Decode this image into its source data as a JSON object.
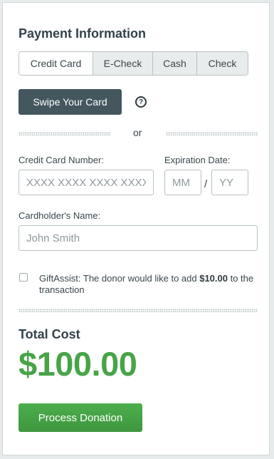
{
  "form": {
    "title": "Payment Information",
    "tabs": [
      "Credit Card",
      "E-Check",
      "Cash",
      "Check"
    ],
    "selected_tab": "Credit Card",
    "swipe_label": "Swipe Your Card",
    "help_glyph": "?",
    "divider_text": "or",
    "card_number_label": "Credit Card Number:",
    "card_number_placeholder": "XXXX XXXX XXXX XXXX",
    "expiration_label": "Expiration Date:",
    "exp_month_placeholder": "MM",
    "exp_separator": "/",
    "exp_year_placeholder": "YY",
    "cardholder_label": "Cardholder's Name:",
    "cardholder_placeholder": "John Smith",
    "gift_assist": {
      "checked": false,
      "text_before": "GiftAssist: The donor would like to add ",
      "amount": "$10.00",
      "text_after": " to the transaction"
    },
    "total_label": "Total Cost",
    "total_amount": "$100.00",
    "submit_label": "Process Donation"
  },
  "colors": {
    "primary_dark": "#44575f",
    "success_green": "#47a447",
    "background": "#e7ebec"
  },
  "icons": {
    "help": "question-circle-icon"
  }
}
